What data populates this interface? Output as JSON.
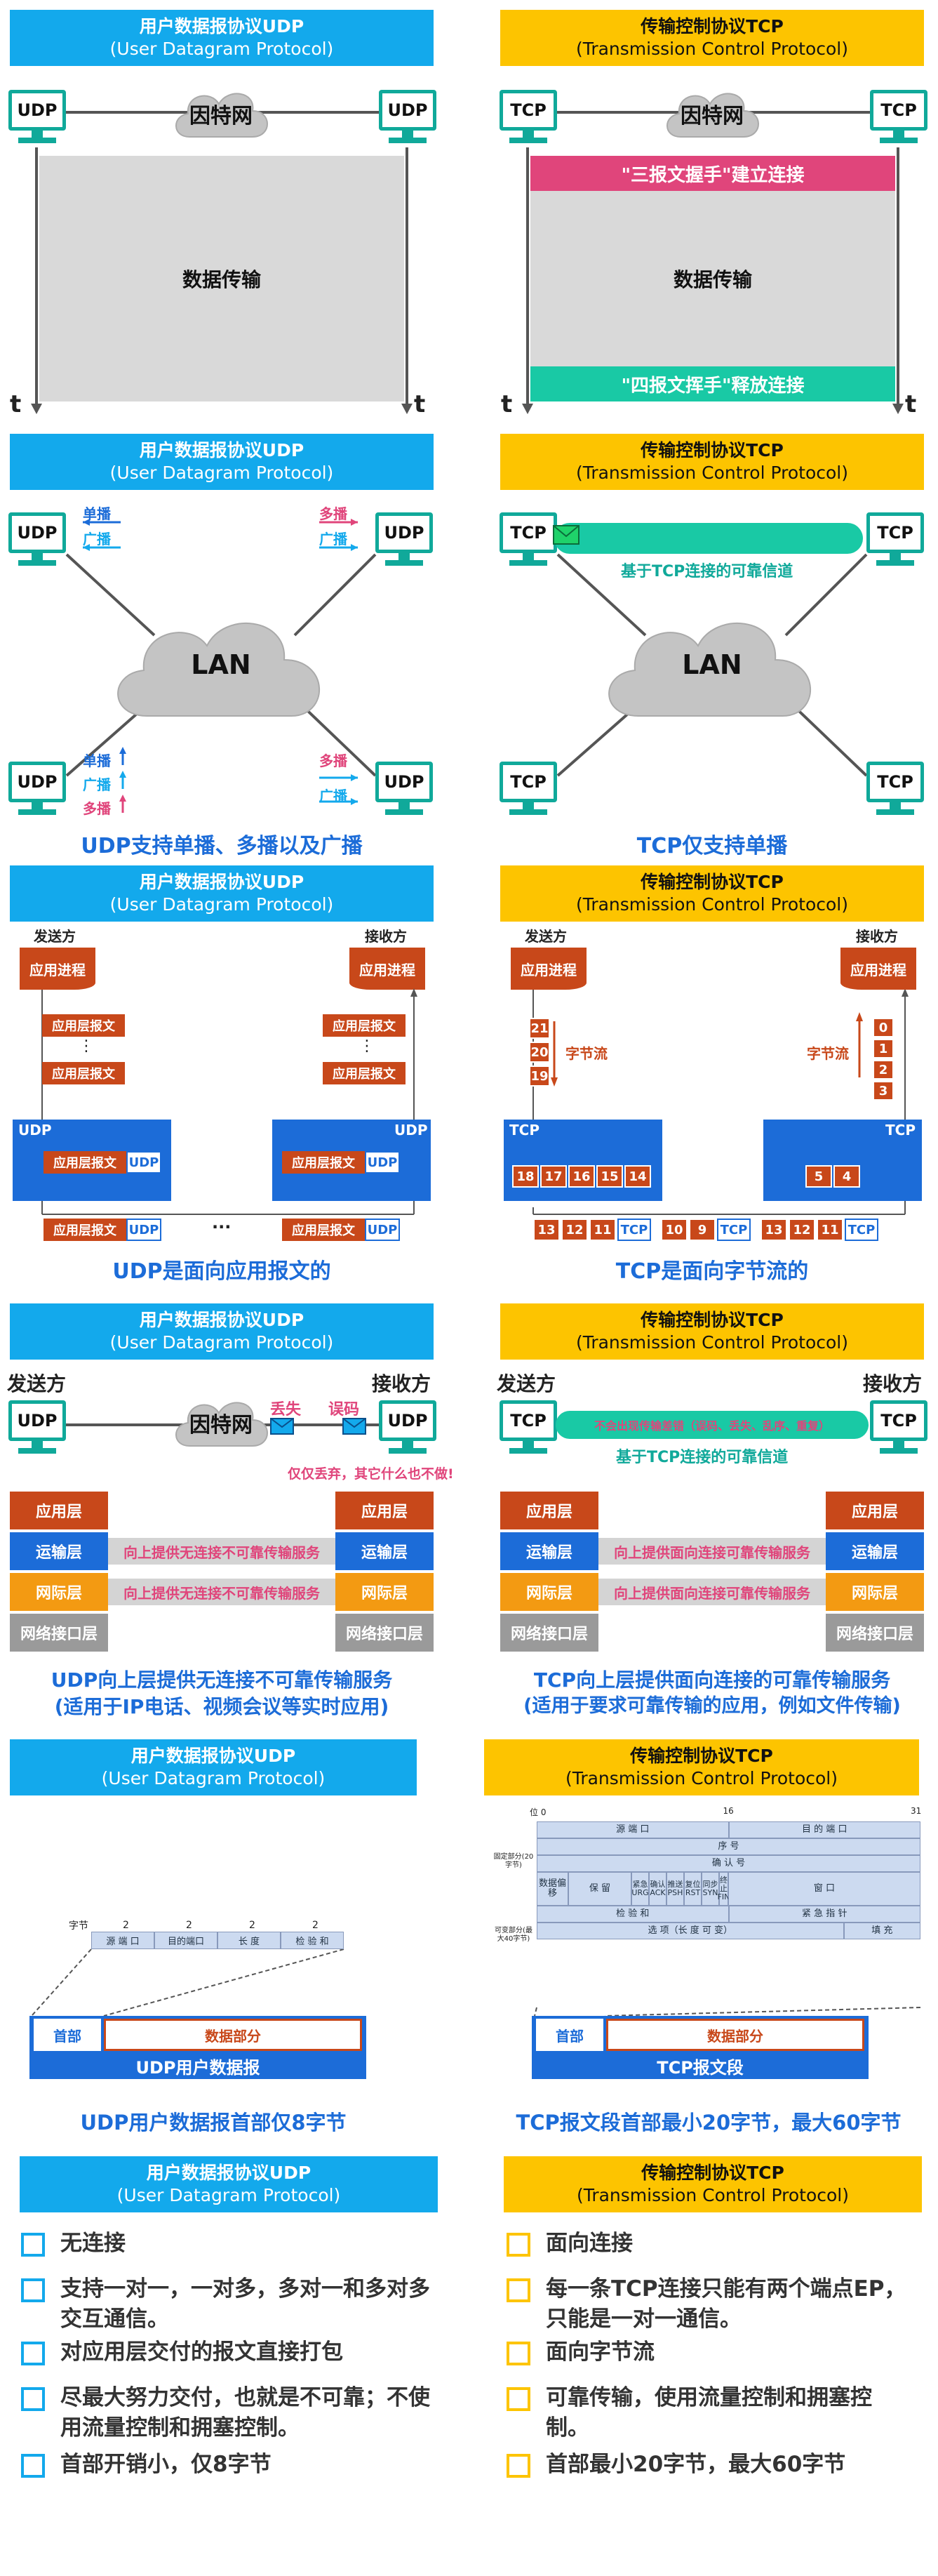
{
  "udp_title": "用户数据报协议UDP",
  "udp_en": "(User Datagram Protocol)",
  "tcp_title": "传输控制协议TCP",
  "tcp_en": "(Transmission Control Protocol)",
  "host_udp": "UDP",
  "host_tcp": "TCP",
  "internet": "因特网",
  "lan": "LAN",
  "time_axis": "t",
  "s1": {
    "data_transfer": "数据传输",
    "handshake": "\"三报文握手\"建立连接",
    "wave": "\"四报文挥手\"释放连接"
  },
  "s2": {
    "unicast": "单播",
    "multicast": "多播",
    "broadcast": "广播",
    "tcp_channel": "基于TCP连接的可靠信道",
    "udp_caption": "UDP支持单播、多播以及广播",
    "tcp_caption": "TCP仅支持单播"
  },
  "s3": {
    "sender": "发送方",
    "receiver": "接收方",
    "app_process": "应用进程",
    "app_msg": "应用层报文",
    "vdots": "⋮",
    "hdots": "···",
    "byte_stream": "字节流",
    "udp_label": "UDP",
    "tcp_label": "TCP",
    "send_stack": [
      "21",
      "20",
      "19"
    ],
    "recv_stack": [
      "0",
      "1",
      "2",
      "3"
    ],
    "send_buffer": [
      "18",
      "17",
      "16",
      "15",
      "14"
    ],
    "recv_buffer": [
      "5",
      "4"
    ],
    "seg1": [
      "13",
      "12",
      "11"
    ],
    "seg2": [
      "10",
      "9"
    ],
    "seg3": [
      "13",
      "12",
      "11"
    ],
    "udp_caption": "UDP是面向应用报文的",
    "tcp_caption": "TCP是面向字节流的"
  },
  "s4": {
    "sender": "发送方",
    "receiver": "接收方",
    "lost": "丢失",
    "error": "误码",
    "udp_note": "仅仅丢弃，其它什么也不做!",
    "tcp_channel_text": "不会出现传输差错（误码、丢失、乱序、重复）",
    "tcp_channel": "基于TCP连接的可靠信道",
    "layers": [
      "应用层",
      "运输层",
      "网际层",
      "网络接口层"
    ],
    "udp_service": "向上提供无连接不可靠传输服务",
    "tcp_service": "向上提供面向连接可靠传输服务",
    "udp_caption1": "UDP向上层提供无连接不可靠传输服务",
    "udp_caption2": "(适用于IP电话、视频会议等实时应用)",
    "tcp_caption1": "TCP向上层提供面向连接的可靠传输服务",
    "tcp_caption2": "(适用于要求可靠传输的应用，例如文件传输)"
  },
  "s5": {
    "byte_label": "字节",
    "udp_byte_counts": [
      "2",
      "2",
      "2",
      "2"
    ],
    "udp_fields": [
      "源 端 口",
      "目的端口",
      "长 度",
      "检 验 和"
    ],
    "header": "首部",
    "data_part": "数据部分",
    "udp_datagram": "UDP用户数据报",
    "tcp_segment": "TCP报文段",
    "bit_marks": [
      "位 0",
      "16",
      "31"
    ],
    "tcp_rows": [
      [
        "源 端 口",
        "目 的 端 口"
      ],
      [
        "序 号"
      ],
      [
        "确 认 号"
      ],
      [
        "数据偏移",
        "保 留",
        "紧急 URG",
        "确认 ACK",
        "推送 PSH",
        "复位 RST",
        "同步 SYN",
        "终止 FIN",
        "窗 口"
      ],
      [
        "检 验 和",
        "紧 急 指 针"
      ],
      [
        "选 项（长 度 可 变）",
        "填 充"
      ]
    ],
    "fixed_part": "固定部分(20字节)",
    "var_part": "可变部分(最大40字节)",
    "udp_caption": "UDP用户数据报首部仅8字节",
    "tcp_caption": "TCP报文段首部最小20字节，最大60字节"
  },
  "s6": {
    "udp_items": [
      "无连接",
      "支持一对一，一对多，多对一和多对多交互通信。",
      "对应用层交付的报文直接打包",
      "尽最大努力交付，也就是不可靠；不使用流量控制和拥塞控制。",
      "首部开销小，仅8字节"
    ],
    "tcp_items": [
      "面向连接",
      "每一条TCP连接只能有两个端点EP，只能是一对一通信。",
      "面向字节流",
      "可靠传输，使用流量控制和拥塞控制。",
      "首部最小20字节，最大60字节"
    ]
  },
  "colors": {
    "udp_blue": "#13a9ec",
    "tcp_yellow": "#fdc400",
    "host_green": "#10a99a",
    "handshake_pink": "#e0457b",
    "wave_teal": "#19c9a5",
    "layer_app": "#c8481a",
    "layer_trans": "#1c6cd8",
    "layer_net": "#f39a12",
    "layer_link": "#9a9a9a",
    "caption_blue": "#1c6cd8"
  }
}
